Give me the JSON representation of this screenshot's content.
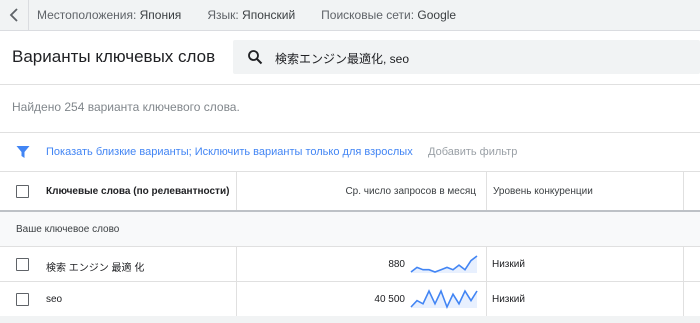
{
  "topbar": {
    "location_label": "Местоположения:",
    "location_value": "Япония",
    "language_label": "Язык:",
    "language_value": "Японский",
    "network_label": "Поисковые сети:",
    "network_value": "Google"
  },
  "header": {
    "title": "Варианты ключевых слов",
    "search_value": "検索エンジン最適化, seo"
  },
  "summary": "Найдено 254 варианта ключевого слова.",
  "filters": {
    "active": "Показать близкие варианты; Исключить варианты только для взрослых",
    "add": "Добавить фильтр"
  },
  "table": {
    "columns": {
      "keyword": "Ключевые слова (по релевантности)",
      "avg": "Ср. число запросов в месяц",
      "competition": "Уровень конкуренции"
    },
    "group_label": "Ваше ключевое слово",
    "rows": [
      {
        "keyword": "検索 エンジン 最適 化",
        "avg": "880",
        "competition": "Низкий",
        "trend": [
          4,
          6,
          5,
          5,
          4,
          5,
          6,
          5,
          7,
          5,
          9,
          11
        ]
      },
      {
        "keyword": "seo",
        "avg": "40 500",
        "competition": "Низкий",
        "trend": [
          4,
          6,
          5,
          9,
          5,
          9,
          4,
          8,
          5,
          9,
          6,
          9
        ]
      }
    ]
  },
  "colors": {
    "accent": "#4285f4",
    "spark_line": "#4285f4"
  },
  "icons": {
    "back": "chevron-left-icon",
    "search": "search-icon",
    "filter": "filter-icon"
  }
}
